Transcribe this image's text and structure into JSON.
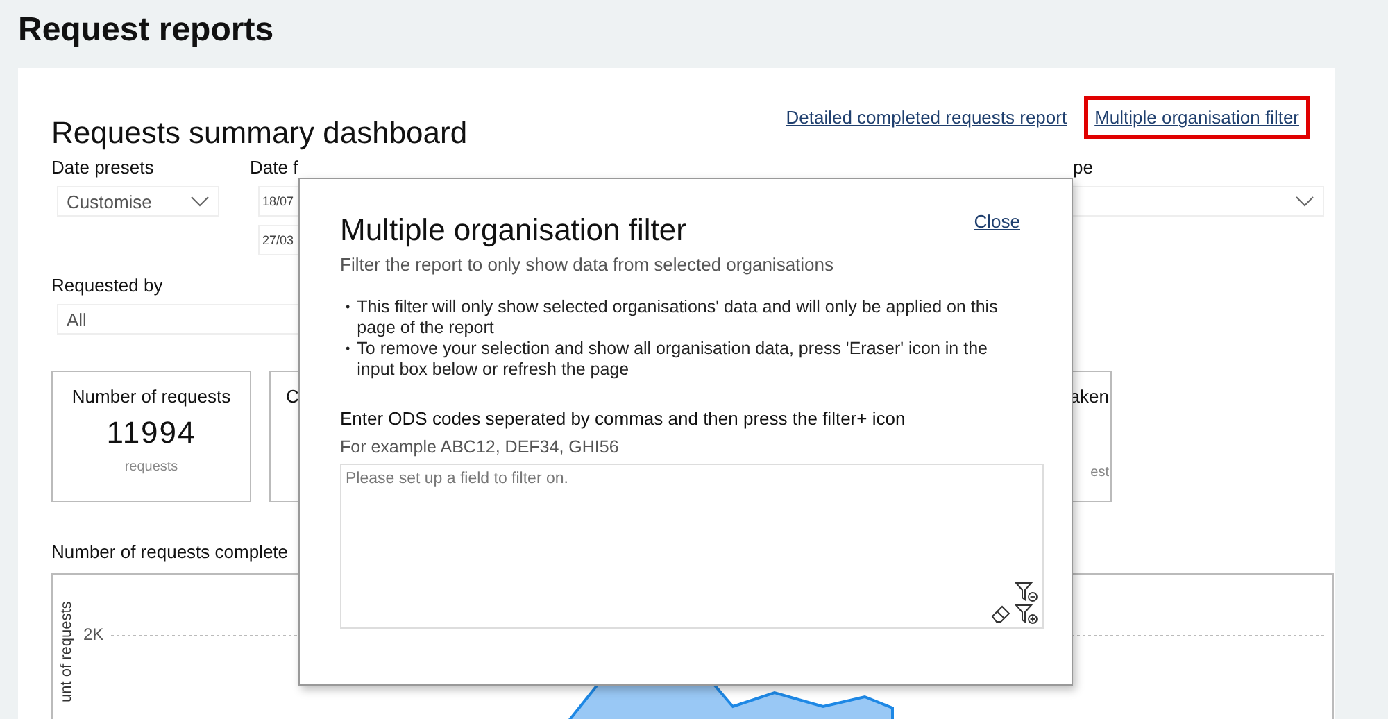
{
  "page": {
    "title": "Request reports"
  },
  "dashboard": {
    "title": "Requests summary dashboard",
    "links": [
      {
        "label": "Detailed completed requests report",
        "highlighted": false
      },
      {
        "label": "Multiple organisation filter",
        "highlighted": true
      }
    ],
    "date_presets": {
      "label": "Date presets",
      "value": "Customise"
    },
    "date_from": {
      "label": "Date f",
      "values": [
        "18/07",
        "27/03"
      ]
    },
    "right_filter": {
      "label": "pe"
    },
    "requested_by": {
      "label": "Requested by",
      "value": "All"
    },
    "cards": [
      {
        "kind": "full",
        "title": "Number of requests",
        "value": "11994",
        "unit": "requests"
      },
      {
        "kind": "cut_right",
        "title": "C"
      },
      {
        "kind": "cut_left",
        "title": "aken",
        "unit": "est"
      }
    ],
    "chart": {
      "title": "Number of requests complete",
      "ylabel": "unt of requests",
      "ytick": "2K"
    }
  },
  "modal": {
    "title": "Multiple organisation filter",
    "close": "Close",
    "subtitle": "Filter the report to only show data from selected organisations",
    "bullets": [
      {
        "marker": "•",
        "text": "This filter will only show selected organisations' data and will only be applied on this page of the report"
      },
      {
        "marker": "•",
        "text": "To remove your selection and show all organisation data, press 'Eraser' icon in the input box below or refresh the page"
      }
    ],
    "instruction": "Enter ODS codes seperated by commas and then press the filter+ icon",
    "example": "For example ABC12, DEF34, GHI56",
    "input": {
      "placeholder": "Please set up a field to filter on."
    }
  }
}
